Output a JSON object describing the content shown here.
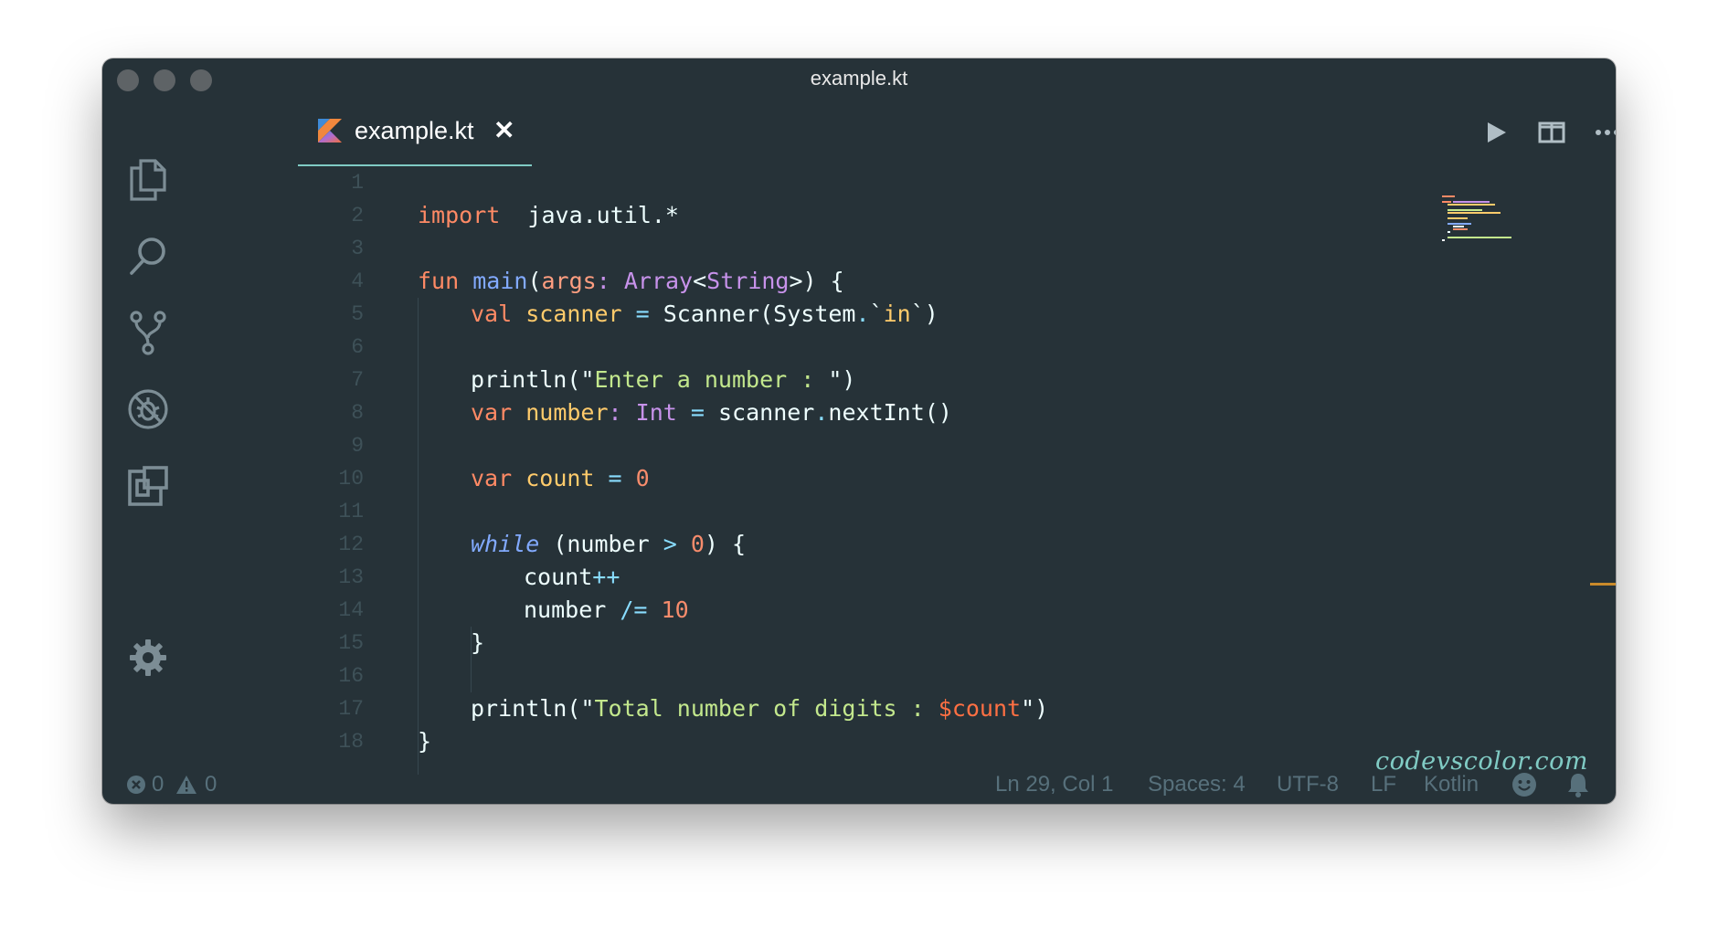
{
  "window": {
    "title": "example.kt"
  },
  "activity_bar": {
    "icons": [
      "explorer-icon",
      "search-icon",
      "source-control-icon",
      "debug-icon",
      "extensions-icon"
    ],
    "bottom_icon": "gear-icon"
  },
  "tab": {
    "label": "example.kt",
    "close_glyph": "✕",
    "logo": "kotlin-logo-icon"
  },
  "editor_actions": [
    "run-icon",
    "split-editor-icon",
    "more-actions-icon"
  ],
  "colors": {
    "background": "#263238",
    "keyword": "#ff8a65",
    "function": "#82aaff",
    "type": "#c792ea",
    "operator": "#89ddff",
    "string": "#c3e88d",
    "number": "#f78c6c",
    "variable": "#ffcb6b",
    "tab_underline": "#80cbc4"
  },
  "code": {
    "line_numbers": [
      "1",
      "2",
      "3",
      "4",
      "5",
      "6",
      "7",
      "8",
      "9",
      "10",
      "11",
      "12",
      "13",
      "14",
      "15",
      "16",
      "17",
      "18"
    ],
    "lines": [
      {
        "n": 1,
        "indent": 0,
        "tokens": []
      },
      {
        "n": 2,
        "indent": 0,
        "tokens": [
          [
            "kw",
            "import"
          ],
          [
            "",
            "  java.util.*"
          ]
        ]
      },
      {
        "n": 3,
        "indent": 0,
        "tokens": []
      },
      {
        "n": 4,
        "indent": 0,
        "tokens": [
          [
            "kw",
            "fun"
          ],
          [
            "",
            " "
          ],
          [
            "fn",
            "main"
          ],
          [
            "",
            "("
          ],
          [
            "pa",
            "args"
          ],
          [
            "ty",
            ":"
          ],
          [
            "",
            " "
          ],
          [
            "ty",
            "Array"
          ],
          [
            "",
            "<"
          ],
          [
            "ty",
            "String"
          ],
          [
            "",
            ">) {"
          ]
        ]
      },
      {
        "n": 5,
        "indent": 1,
        "tokens": [
          [
            "kw",
            "val"
          ],
          [
            "",
            " "
          ],
          [
            "va",
            "scanner"
          ],
          [
            "",
            " "
          ],
          [
            "op",
            "="
          ],
          [
            "",
            " Scanner(System"
          ],
          [
            "op",
            "."
          ],
          [
            "",
            "`"
          ],
          [
            "va",
            "in"
          ],
          [
            "",
            "`)"
          ]
        ]
      },
      {
        "n": 6,
        "indent": 1,
        "tokens": []
      },
      {
        "n": 7,
        "indent": 1,
        "tokens": [
          [
            "",
            "println(\""
          ],
          [
            "st",
            "Enter a number : "
          ],
          [
            "",
            "\")"
          ]
        ]
      },
      {
        "n": 8,
        "indent": 1,
        "tokens": [
          [
            "kw",
            "var"
          ],
          [
            "",
            " "
          ],
          [
            "va",
            "number"
          ],
          [
            "ty",
            ":"
          ],
          [
            "",
            " "
          ],
          [
            "ty",
            "Int"
          ],
          [
            "",
            " "
          ],
          [
            "op",
            "="
          ],
          [
            "",
            " scanner"
          ],
          [
            "op",
            "."
          ],
          [
            "",
            "nextInt()"
          ]
        ]
      },
      {
        "n": 9,
        "indent": 1,
        "tokens": []
      },
      {
        "n": 10,
        "indent": 1,
        "tokens": [
          [
            "kw",
            "var"
          ],
          [
            "",
            " "
          ],
          [
            "va",
            "count"
          ],
          [
            "",
            " "
          ],
          [
            "op",
            "="
          ],
          [
            "",
            " "
          ],
          [
            "nu",
            "0"
          ]
        ]
      },
      {
        "n": 11,
        "indent": 1,
        "tokens": []
      },
      {
        "n": 12,
        "indent": 1,
        "tokens": [
          [
            "kwi",
            "while"
          ],
          [
            "",
            " (number "
          ],
          [
            "op",
            ">"
          ],
          [
            "",
            " "
          ],
          [
            "nu",
            "0"
          ],
          [
            "",
            ") {"
          ]
        ]
      },
      {
        "n": 13,
        "indent": 2,
        "tokens": [
          [
            "",
            "count"
          ],
          [
            "op",
            "++"
          ]
        ]
      },
      {
        "n": 14,
        "indent": 2,
        "tokens": [
          [
            "",
            "number "
          ],
          [
            "op",
            "/="
          ],
          [
            "",
            " "
          ],
          [
            "nu",
            "10"
          ]
        ]
      },
      {
        "n": 15,
        "indent": 1,
        "tokens": [
          [
            "",
            "}"
          ]
        ]
      },
      {
        "n": 16,
        "indent": 1,
        "tokens": []
      },
      {
        "n": 17,
        "indent": 1,
        "tokens": [
          [
            "",
            "println(\""
          ],
          [
            "st",
            "Total number of digits : "
          ],
          [
            "tp",
            "$count"
          ],
          [
            "",
            "\")"
          ]
        ]
      },
      {
        "n": 18,
        "indent": 0,
        "tokens": [
          [
            "",
            "}"
          ]
        ]
      }
    ]
  },
  "watermark": "codevscolor.com",
  "status_bar": {
    "errors": "0",
    "warnings": "0",
    "position": "Ln 29, Col 1",
    "spaces": "Spaces: 4",
    "encoding": "UTF-8",
    "eol": "LF",
    "language": "Kotlin",
    "feedback_icon": "smiley-icon",
    "notifications_icon": "bell-icon"
  }
}
